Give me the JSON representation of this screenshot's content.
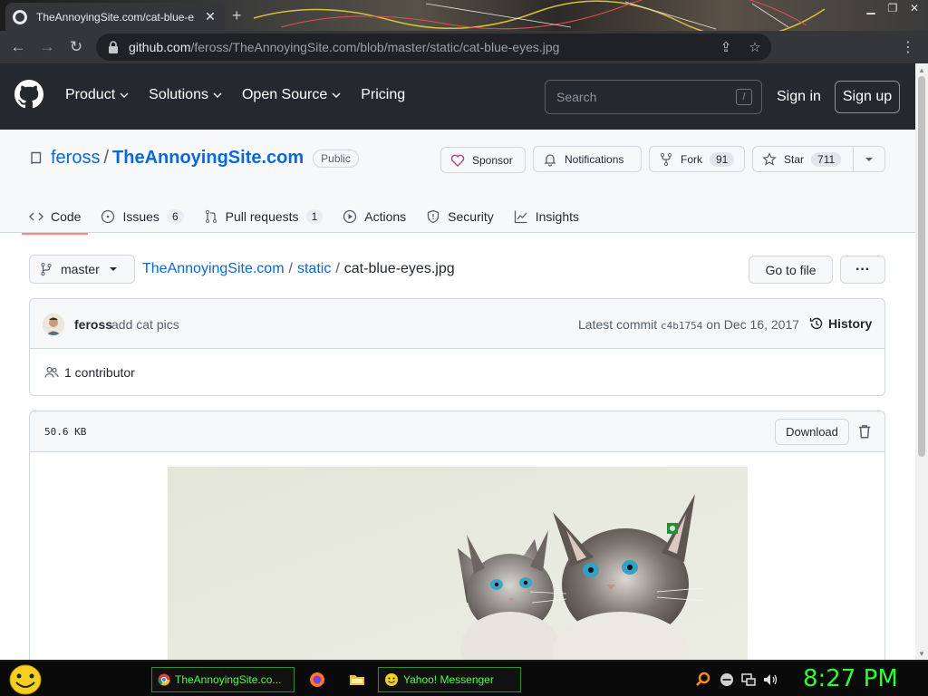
{
  "browser": {
    "tab_title": "TheAnnoyingSite.com/cat-blue-e",
    "tab_close": "✕",
    "url_host": "github.com",
    "url_path": "/feross/TheAnnoyingSite.com/blob/master/static/cat-blue-eyes.jpg"
  },
  "header": {
    "nav": [
      "Product",
      "Solutions",
      "Open Source",
      "Pricing"
    ],
    "search_placeholder": "Search",
    "search_shortcut": "/",
    "sign_in": "Sign in",
    "sign_up": "Sign up"
  },
  "repo": {
    "owner": "feross",
    "separator": "/",
    "name": "TheAnnoyingSite.com",
    "visibility": "Public",
    "sponsor_label": "Sponsor",
    "notifications_label": "Notifications",
    "fork_label": "Fork",
    "fork_count": "91",
    "star_label": "Star",
    "star_count": "711",
    "tabs": [
      {
        "label": "Code",
        "count": ""
      },
      {
        "label": "Issues",
        "count": "6"
      },
      {
        "label": "Pull requests",
        "count": "1"
      },
      {
        "label": "Actions",
        "count": ""
      },
      {
        "label": "Security",
        "count": ""
      },
      {
        "label": "Insights",
        "count": ""
      }
    ]
  },
  "file_nav": {
    "branch": "master",
    "crumb_root": "TheAnnoyingSite.com",
    "crumb_dir": "static",
    "crumb_file": "cat-blue-eyes.jpg",
    "sep": "/",
    "go_to_file": "Go to file",
    "more": "···"
  },
  "commit": {
    "author": "feross",
    "message": "add cat pics",
    "latest_label": "Latest commit",
    "sha": "c4b1754",
    "date": "on Dec 16, 2017",
    "history_label": "History",
    "contributors": "1 contributor"
  },
  "file": {
    "size": "50.6 KB",
    "download_label": "Download"
  },
  "taskbar": {
    "task1": "TheAnnoyingSite.co...",
    "task2": "Yahoo! Messenger",
    "clock": "8:27 PM"
  },
  "colors": {
    "link": "#0969da",
    "header_bg": "#24292f",
    "tab_underline": "#fd8c73",
    "taskbar_text": "#4cff4c"
  }
}
